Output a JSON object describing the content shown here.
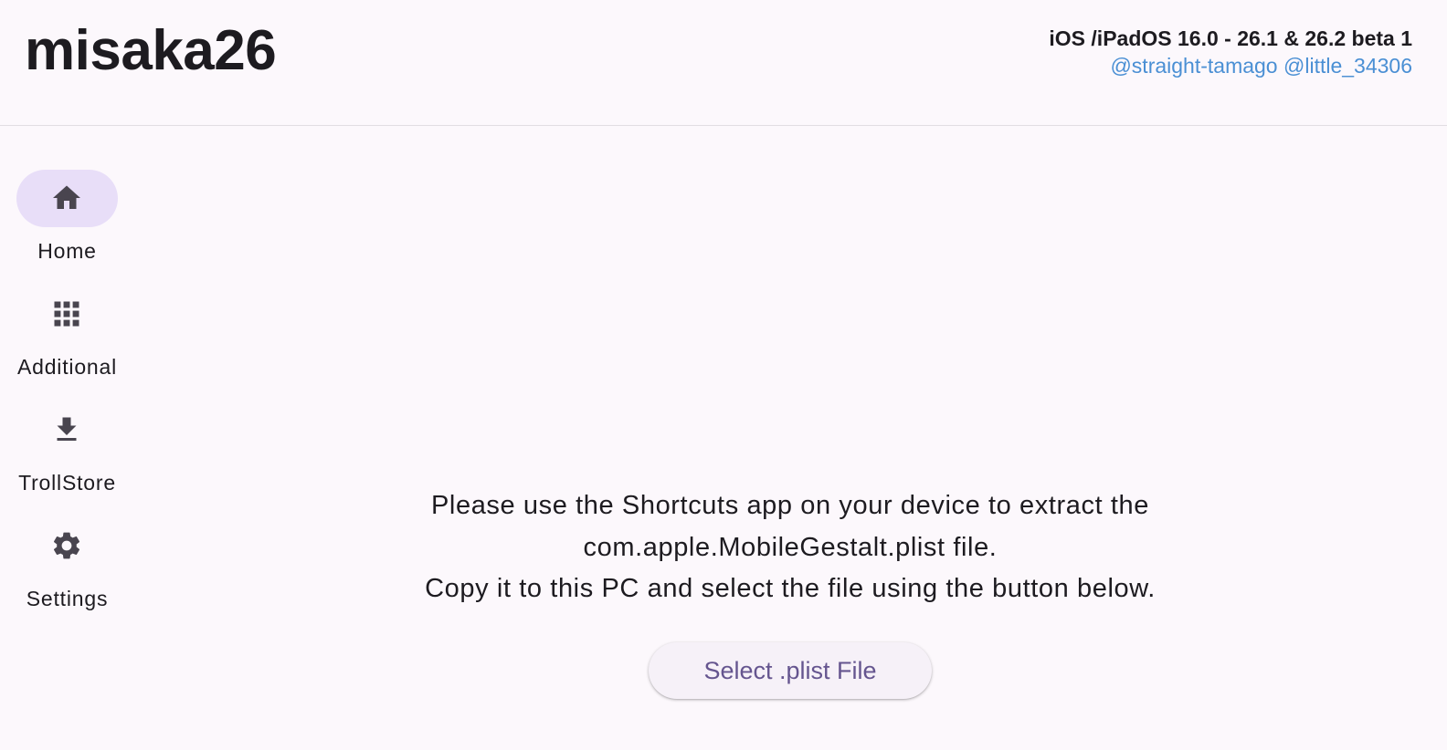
{
  "header": {
    "title": "misaka26",
    "version": "iOS /iPadOS 16.0 - 26.1 & 26.2 beta 1",
    "credit_1": "@straight-tamago",
    "credit_2": "@little_34306",
    "credit_color": "#4a8fd4"
  },
  "nav": {
    "items": [
      {
        "label": "Home",
        "icon": "home-icon",
        "active": true
      },
      {
        "label": "Additional",
        "icon": "apps-grid-icon",
        "active": false
      },
      {
        "label": "TrollStore",
        "icon": "download-icon",
        "active": false
      },
      {
        "label": "Settings",
        "icon": "gear-icon",
        "active": false
      }
    ],
    "active_indicator_color": "#e8def8"
  },
  "main": {
    "instruction_line_1": "Please use the Shortcuts app on your device to extract the",
    "instruction_line_2": "com.apple.MobileGestalt.plist file.",
    "instruction_line_3": "Copy it to this PC and select the file using the button below.",
    "button_label": "Select .plist File",
    "button_color": "#65558f"
  }
}
